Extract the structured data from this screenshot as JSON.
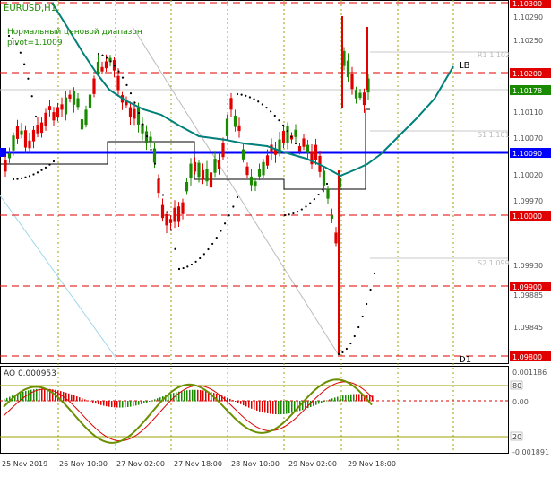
{
  "window": {
    "symbol_label": "EURUSD,H1"
  },
  "annotations": {
    "range_title": "Нормальный ценовой диапазон",
    "pivot_text": "pivot=1.1009",
    "r1": "R1 1.102",
    "s1": "S1 1.101",
    "s2": "S2 1.099",
    "lb": "LB",
    "d1": "D1"
  },
  "price_axis": {
    "labels": [
      "1.10290",
      "1.10250",
      "1.10110",
      "1.10070",
      "1.10020",
      "1.09970",
      "1.09930",
      "1.09885",
      "1.09845"
    ],
    "highlights": [
      {
        "text": "1.10300",
        "color": "#e00000"
      },
      {
        "text": "1.10200",
        "color": "#e00000"
      },
      {
        "text": "1.10178",
        "color": "#1a8a00"
      },
      {
        "text": "1.10090",
        "color": "#0000ff"
      },
      {
        "text": "1.10000",
        "color": "#e00000"
      },
      {
        "text": "1.09900",
        "color": "#e00000"
      },
      {
        "text": "1.09800",
        "color": "#e00000"
      }
    ]
  },
  "time_axis": [
    "25 Nov 2019",
    "26 Nov 10:00",
    "27 Nov 02:00",
    "27 Nov 18:00",
    "28 Nov 10:00",
    "29 Nov 02:00",
    "29 Nov 18:00"
  ],
  "indicator": {
    "label": "AO 0.000953",
    "axis": [
      "0.001186",
      "0.00",
      "-0.001891"
    ],
    "levels": [
      "80",
      "20"
    ]
  },
  "colors": {
    "bull": "#1a8a00",
    "bear": "#e00000",
    "pivot": "#0000ff",
    "ma": "#00807a",
    "grid": "#9aa000"
  }
}
